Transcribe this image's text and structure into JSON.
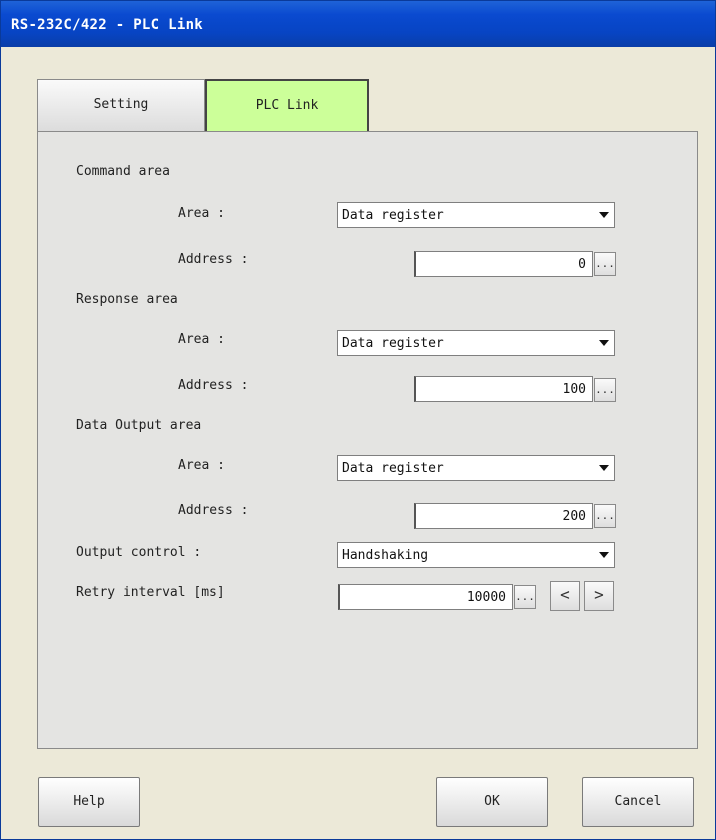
{
  "window": {
    "title": "RS-232C/422 - PLC Link"
  },
  "tabs": [
    {
      "label": "Setting",
      "active": false
    },
    {
      "label": "PLC Link",
      "active": true
    }
  ],
  "command_area": {
    "section_label": "Command area",
    "area_label": "Area :",
    "area_value": "Data register",
    "address_label": "Address :",
    "address_value": "0"
  },
  "response_area": {
    "section_label": "Response area",
    "area_label": "Area :",
    "area_value": "Data register",
    "address_label": "Address :",
    "address_value": "100"
  },
  "data_output_area": {
    "section_label": "Data Output area",
    "area_label": "Area :",
    "area_value": "Data register",
    "address_label": "Address :",
    "address_value": "200"
  },
  "output_control": {
    "label": "Output control :",
    "value": "Handshaking"
  },
  "retry_interval": {
    "label": "Retry interval [ms]",
    "value": "10000"
  },
  "misc": {
    "dots": "...",
    "prev": "<",
    "next": ">"
  },
  "footer": {
    "help": "Help",
    "ok": "OK",
    "cancel": "Cancel"
  },
  "colors": {
    "title_bar": "#0a4ad0",
    "active_tab": "#ccff99",
    "background": "#ece9d8"
  }
}
